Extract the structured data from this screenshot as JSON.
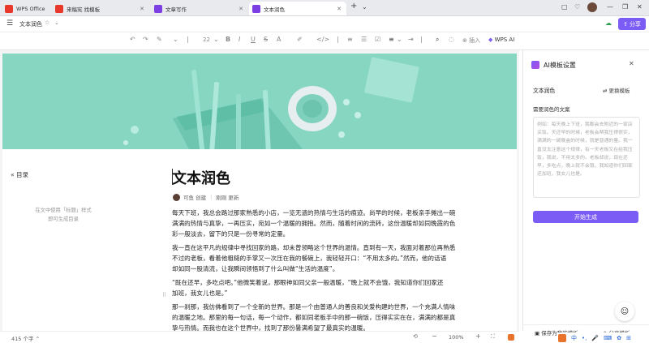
{
  "tabs": [
    {
      "label": "WPS Office",
      "color": "#e8382c"
    },
    {
      "label": "来稿宪 找模板",
      "color": "#e8382c"
    },
    {
      "label": "文章写作",
      "color": "#7b3fe4"
    },
    {
      "label": "文本润色",
      "color": "#7b3fe4"
    }
  ],
  "menubar": {
    "doc_name": "文本润色",
    "share_label": "分享"
  },
  "toolbar": {
    "font_size": "22",
    "insert_label": "插入",
    "wps_ai_label": "WPS AI"
  },
  "outline": {
    "title": "目录",
    "hint_line1": "在文中使用「标题」样式",
    "hint_line2": "即可生成目录"
  },
  "document": {
    "title": "文本润色",
    "author": "可鱼 创建",
    "edit_time": "刚刚 更新",
    "paragraphs": [
      [
        "每天下班，我总会路过那家熟悉的小店，一览无遗的热情与生活的痕迹。尚早的时候，老板亲手摊出一碗",
        "满满的热情与真挚，一再压实，宛如一个温暖的拥抱。然而，随着时间的流转，这份温暖却如同晚霞的色",
        "彩一般淡去，留下的只是一份寻常的定量。"
      ],
      [
        "我一直在这平凡的规律中寻找回家的路，却未曾领略这个世界的温情。直到有一天，我面对着那位再熟悉",
        "不过的老板，看着他粗糙的手掌又一次压在我的餐碗上，我轻轻开口：“不用太多的。”然而，他的话语",
        "却如同一股清流，让我瞬间领悟到了什么叫做“生活的温度”。"
      ],
      [
        "“既在还早，多吃点吧。”他微笑着说，那眼神如同父亲一般温暖，“晚上就不会饿，我知道你们回家还",
        "加班，我女儿也是。”"
      ],
      [
        "那一刹那，我仿佛看到了一个全新的世界。那是一个由普通人的善良和关爱构建的世界，一个充满人情味",
        "的温暖之地。那里的每一句话，每一个动作，都如同老板手中的那一碗饭，压得实实在在，满满的都是真",
        "挚与热情。而我也在这个世界中，找到了那份暑满希望了最真实的温暖。"
      ]
    ]
  },
  "panel": {
    "title": "AI模板设置",
    "template_name": "文本润色",
    "change_label": "更换模板",
    "field_label": "需要润色的文案",
    "example_text": "例如：每天晚上下班，我都会去附近的一家店买饭。天还早的时候，老板会帮我压得很实，满满的一碗晚盒的时候，就是普通的量。我一直没太注意这个规律，有一天老板又在给我压饭，我说，不用太多的。老板却说，现在还早，多吃点，晚上就不会饿，我知道你们回家还加班，我女儿也是。",
    "generate_label": "开始生成",
    "save_label": "保存为我的模板",
    "share_label": "分享模板"
  },
  "status": {
    "word_count": "415 个字",
    "zoom": "100%"
  },
  "ime": {
    "lang": "中"
  },
  "colors": {
    "accent": "#7b5cf5",
    "wps_red": "#e8382c",
    "banner": "#84d4c0"
  }
}
